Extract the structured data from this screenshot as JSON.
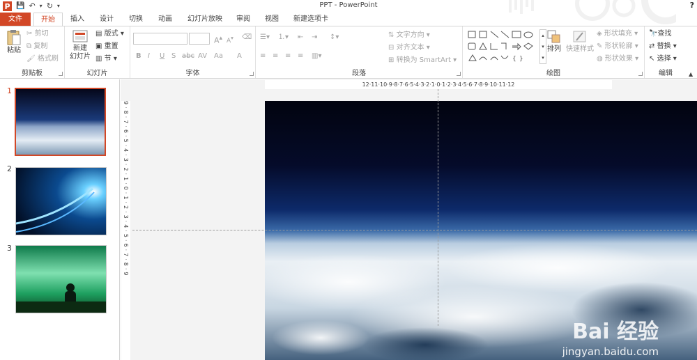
{
  "window": {
    "title": "PPT - PowerPoint",
    "help": "?"
  },
  "qat": {
    "logo": "P",
    "save": "💾",
    "undo": "↶",
    "redo": "↻",
    "more": "▾"
  },
  "tabs": [
    "文件",
    "开始",
    "插入",
    "设计",
    "切换",
    "动画",
    "幻灯片放映",
    "审阅",
    "视图",
    "新建选项卡"
  ],
  "active_tab": "开始",
  "ribbon": {
    "clipboard": {
      "label": "剪贴板",
      "paste": "粘贴",
      "cut": "剪切",
      "copy": "复制",
      "format_painter": "格式刷"
    },
    "slides": {
      "label": "幻灯片",
      "new_slide_line1": "新建",
      "new_slide_line2": "幻灯片",
      "layout": "版式",
      "reset": "重置",
      "section": "节"
    },
    "font": {
      "label": "字体",
      "bold": "B",
      "italic": "I",
      "underline": "U",
      "shadow": "S",
      "strike": "abc",
      "spacing": "AV",
      "case": "Aa",
      "color": "A",
      "grow": "A",
      "shrink": "A"
    },
    "paragraph": {
      "label": "段落",
      "text_direction": "文字方向",
      "align_text": "对齐文本",
      "smartart": "转换为 SmartArt"
    },
    "drawing": {
      "label": "绘图",
      "arrange": "排列",
      "quick_styles": "快速样式",
      "fill": "形状填充",
      "outline": "形状轮廓",
      "effects": "形状效果"
    },
    "editing": {
      "label": "编辑",
      "find": "查找",
      "replace": "替换",
      "select": "选择"
    }
  },
  "slides": [
    {
      "num": "1",
      "selected": true
    },
    {
      "num": "2",
      "selected": false
    },
    {
      "num": "3",
      "selected": false
    }
  ],
  "ruler": {
    "h": "12·11·10·9·8·7·6·5·4·3·2·1·0·1·2·3·4·5·6·7·8·9·10·11·12",
    "v": "9·8·7·6·5·4·3·2·1·0·1·2·3·4·5·6·7·8·9"
  },
  "watermark": {
    "brand": "Bai 经验",
    "url": "jingyan.baidu.com"
  },
  "colors": {
    "accent": "#d24726"
  }
}
